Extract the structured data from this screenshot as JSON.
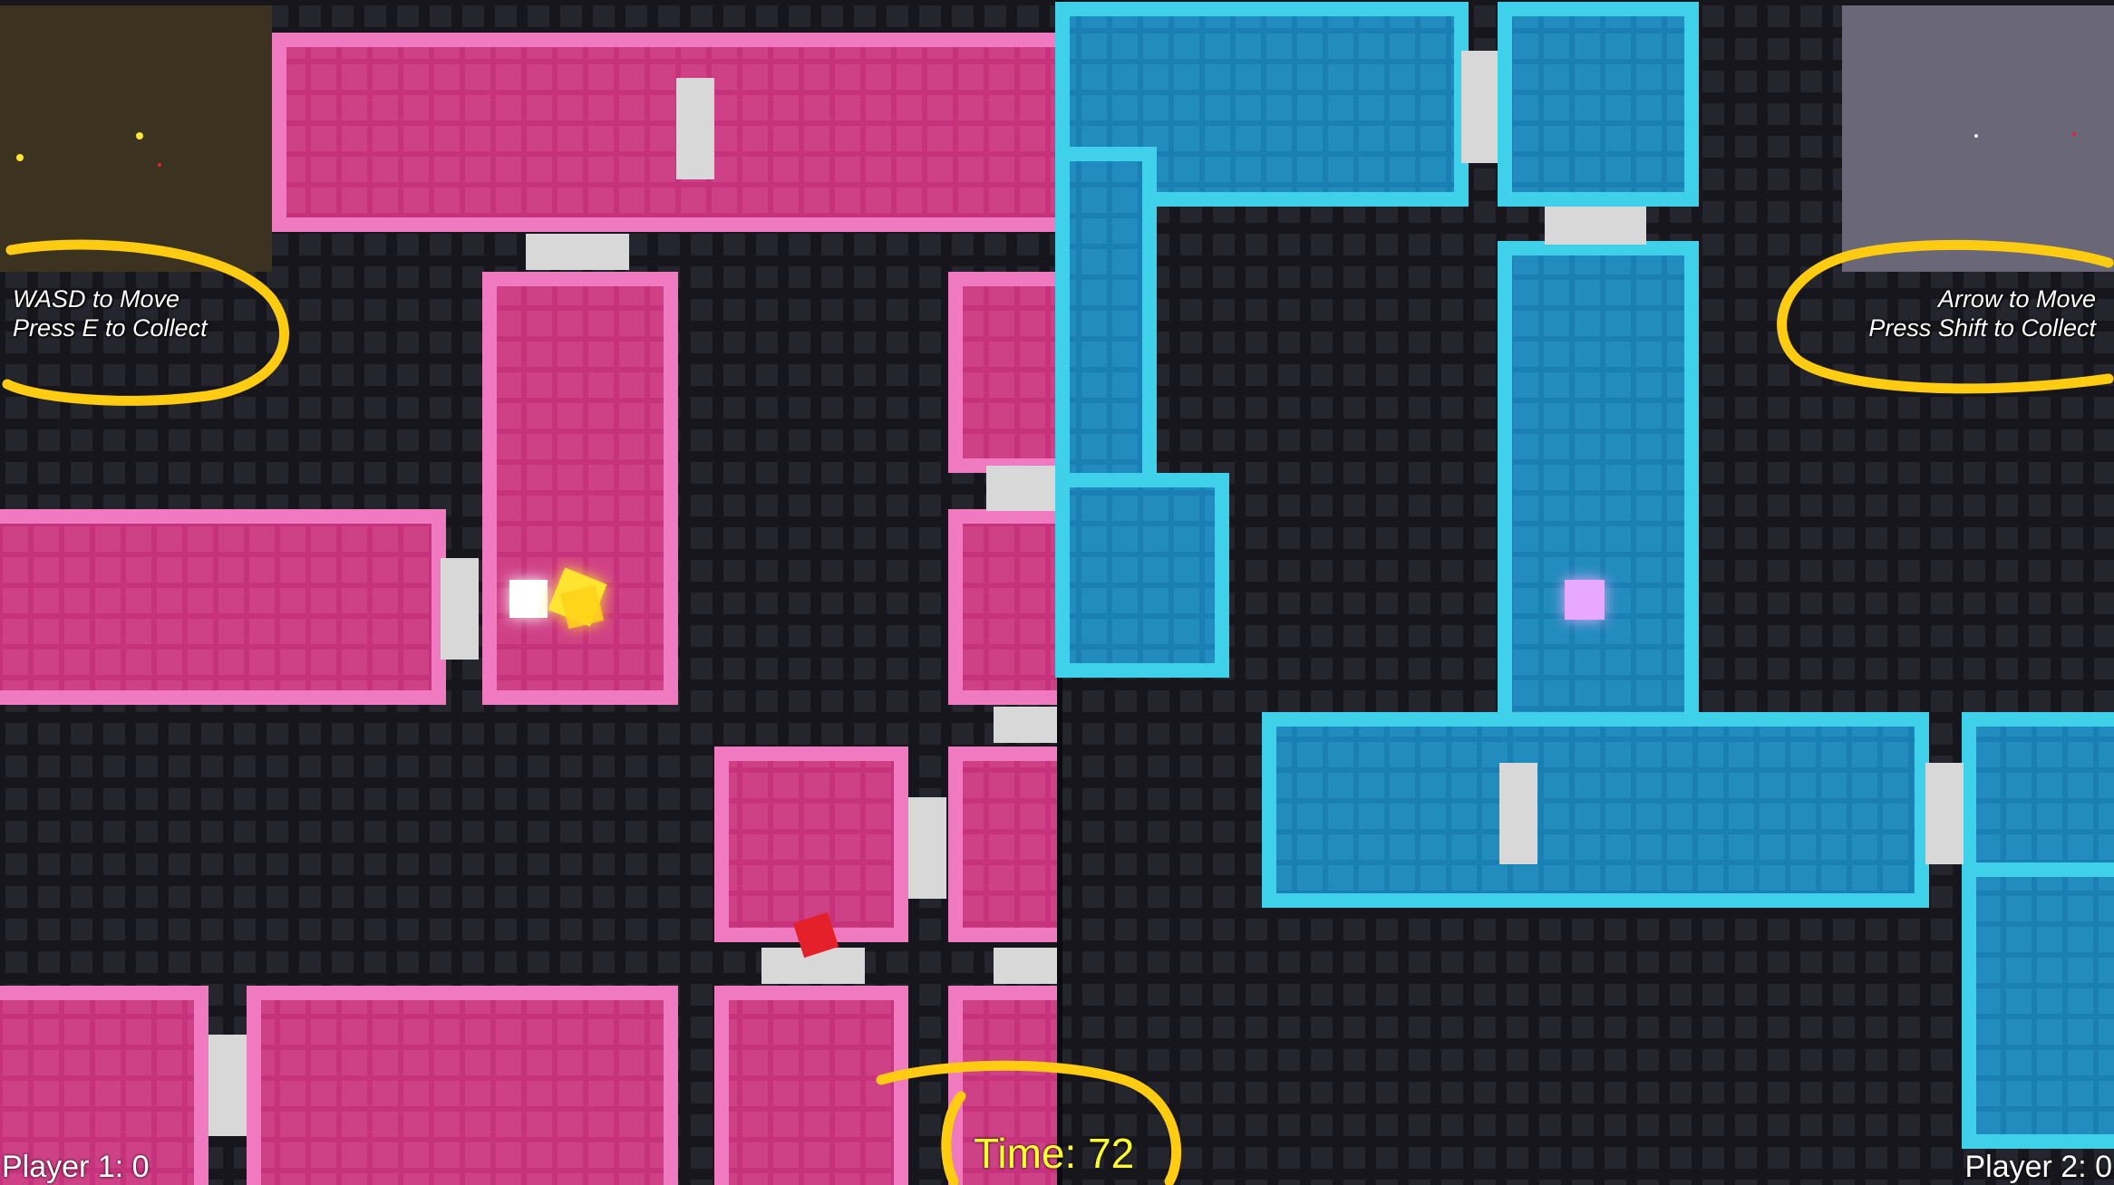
{
  "player1": {
    "controls_line1": "WASD to Move",
    "controls_line2": "Press E to Collect",
    "score_text": "Player 1: 0"
  },
  "player2": {
    "controls_line1": "Arrow to Move",
    "controls_line2": "Press Shift to Collect",
    "score_text": "Player 2: 0"
  },
  "timer_text": "Time: 72",
  "colors": {
    "background": "#14131a",
    "floor_tile": "#24242c",
    "pink_wall": "#c93d84",
    "pink_wall_edge": "#f07ac0",
    "blue_wall": "#1f86b8",
    "blue_wall_edge": "#3fd0ea",
    "door": "#d8d8d8",
    "player1_collectible": "#ffe431",
    "player1_item": "#e4202a",
    "player2_avatar": "#e9a8ff",
    "annotation": "#ffcc11",
    "timer": "#ffff2a",
    "minimap1_bg": "#3c3220",
    "minimap2_bg": "#6a6878"
  },
  "icons": {
    "player1_avatar": "white-cube",
    "player1_target": "yellow-glow-cube",
    "player1_item": "red-cube",
    "player2_avatar": "purple-glow-cube",
    "doors": "grey-rectangle"
  }
}
